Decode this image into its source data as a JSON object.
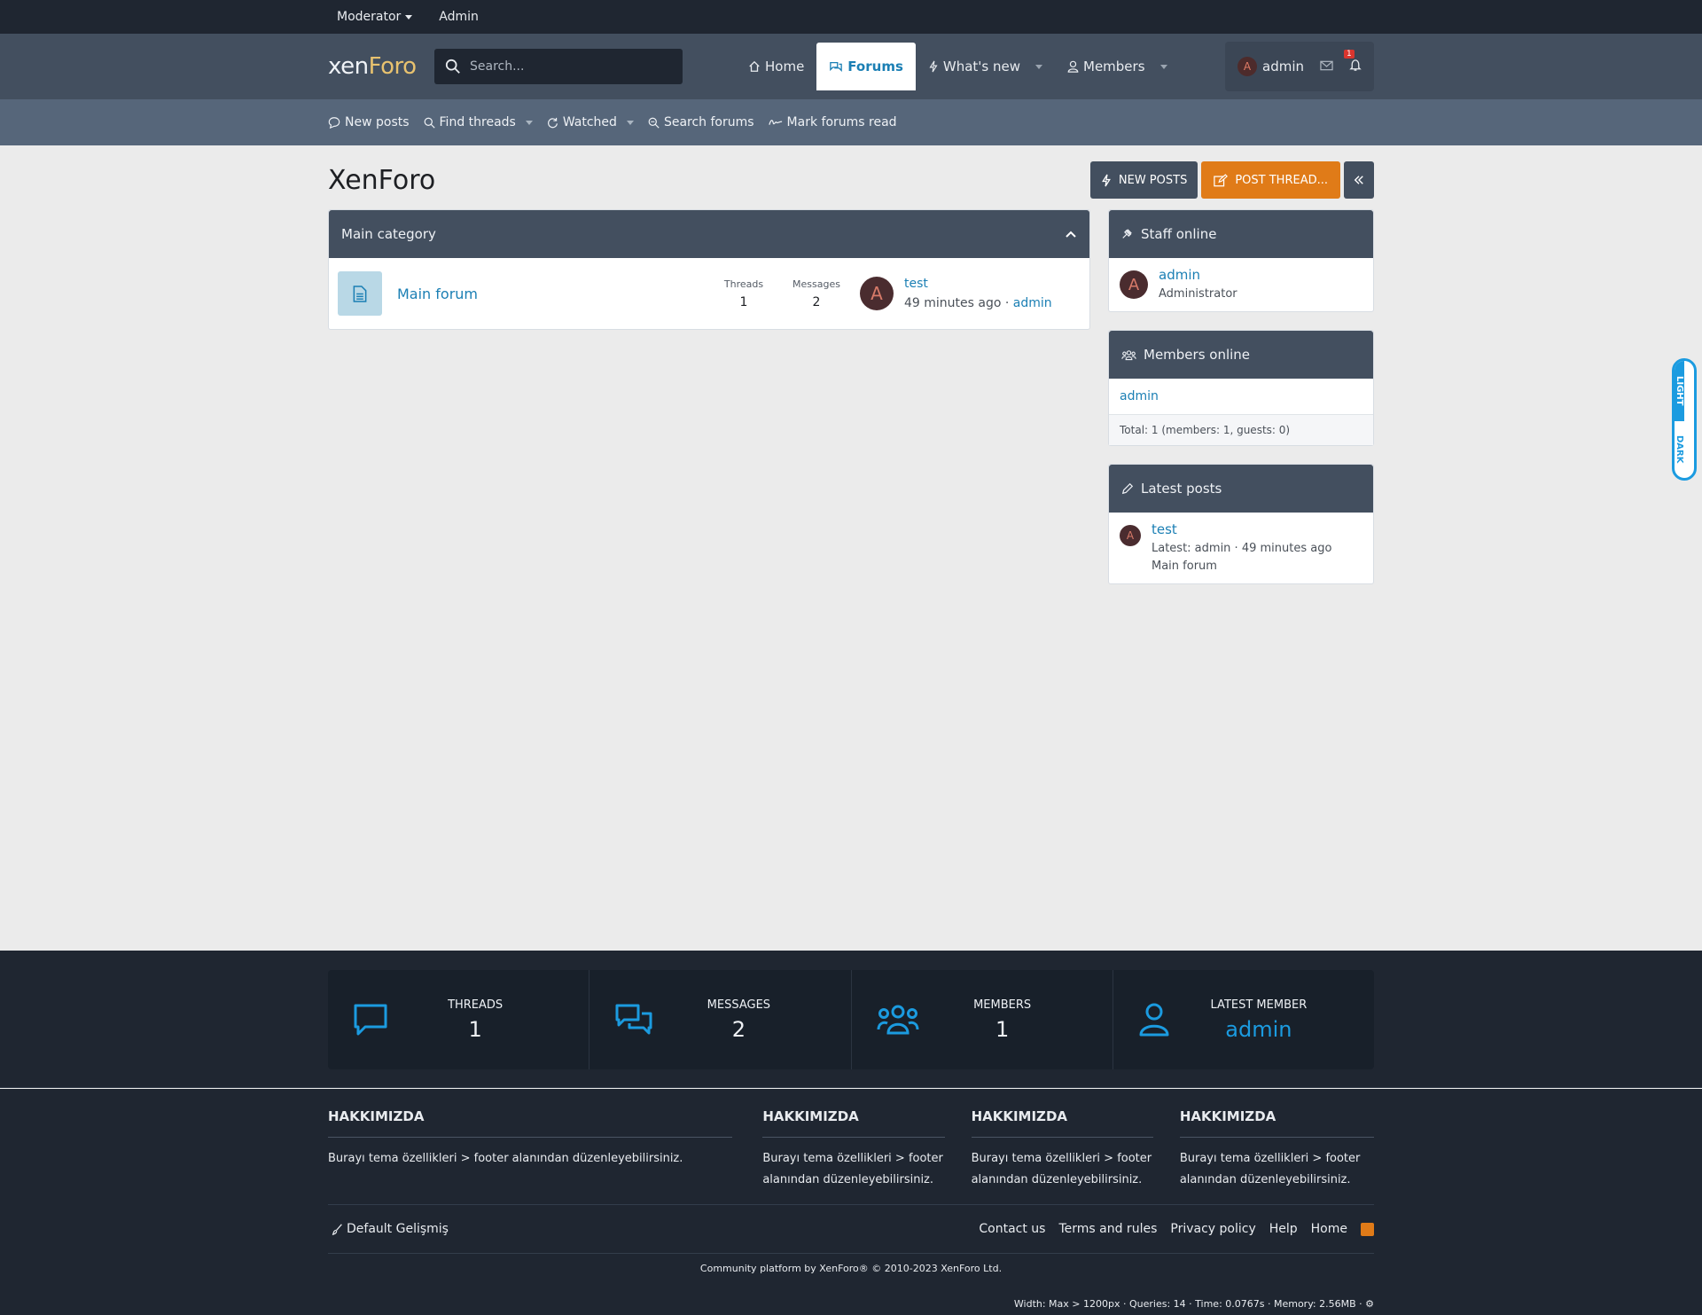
{
  "staffbar": {
    "moderator": "Moderator",
    "admin": "Admin"
  },
  "header": {
    "logo_main": "xen",
    "logo_accent": "Foro",
    "search_placeholder": "Search...",
    "nav": {
      "home": "Home",
      "forums": "Forums",
      "whats_new": "What's new",
      "members": "Members"
    },
    "user": {
      "avatar_letter": "A",
      "name": "admin",
      "alerts_count": "1"
    }
  },
  "subnav": {
    "new_posts": "New posts",
    "find_threads": "Find threads",
    "watched": "Watched",
    "search_forums": "Search forums",
    "mark_read": "Mark forums read"
  },
  "page": {
    "title": "XenForo",
    "actions": {
      "new_posts": "NEW POSTS",
      "post_thread": "POST THREAD..."
    }
  },
  "category": {
    "title": "Main category",
    "node": {
      "title": "Main forum",
      "threads_label": "Threads",
      "threads_value": "1",
      "messages_label": "Messages",
      "messages_value": "2",
      "last_avatar": "A",
      "last_title": "test",
      "last_time": "49 minutes ago",
      "last_sep": " · ",
      "last_user": "admin"
    }
  },
  "sidebar": {
    "staff": {
      "title": "Staff online",
      "avatar": "A",
      "name": "admin",
      "role": "Administrator"
    },
    "members": {
      "title": "Members online",
      "name": "admin",
      "total": "Total: 1 (members: 1, guests: 0)"
    },
    "latest": {
      "title": "Latest posts",
      "avatar": "A",
      "post_title": "test",
      "meta": "Latest: admin · 49 minutes ago",
      "forum": "Main forum"
    }
  },
  "theme_switch": {
    "light": "LIGHT",
    "dark": "DARK"
  },
  "stats": {
    "threads": {
      "label": "THREADS",
      "value": "1"
    },
    "messages": {
      "label": "MESSAGES",
      "value": "2"
    },
    "members": {
      "label": "MEMBERS",
      "value": "1"
    },
    "latest_member": {
      "label": "LATEST MEMBER",
      "value": "admin"
    }
  },
  "footer": {
    "columns": [
      {
        "title": "HAKKIMIZDA",
        "text": "Burayı tema özellikleri > footer alanından düzenleyebilirsiniz."
      },
      {
        "title": "HAKKIMIZDA",
        "text": "Burayı tema özellikleri > footer alanından düzenleyebilirsiniz."
      },
      {
        "title": "HAKKIMIZDA",
        "text": "Burayı tema özellikleri > footer alanından düzenleyebilirsiniz."
      },
      {
        "title": "HAKKIMIZDA",
        "text": "Burayı tema özellikleri > footer alanından düzenleyebilirsiniz."
      }
    ],
    "style_chooser": "Default Gelişmiş",
    "links": {
      "contact": "Contact us",
      "terms": "Terms and rules",
      "privacy": "Privacy policy",
      "help": "Help",
      "home": "Home"
    },
    "copyright": "Community platform by XenForo® © 2010-2023 XenForo Ltd.",
    "debug": "Width: Max > 1200px · Queries: 14 · Time: 0.0767s · Memory: 2.56MB · ⚙"
  },
  "colors": {
    "accent": "#1b7fb4",
    "orange": "#e07b18",
    "header": "#434f5f",
    "dark": "#1f2631"
  }
}
